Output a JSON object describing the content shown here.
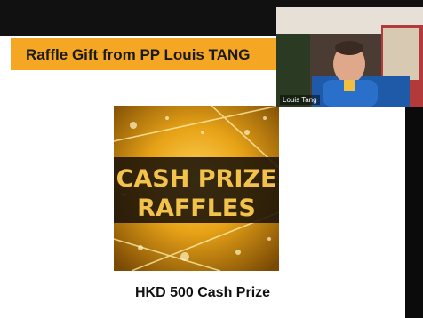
{
  "slide": {
    "banner_title": "Raffle Gift from PP Louis TANG",
    "image_text_line1": "CASH PRIZE",
    "image_text_line2": "RAFFLES",
    "caption": "HKD 500 Cash Prize"
  },
  "video": {
    "participant_name": "Louis Tang"
  },
  "colors": {
    "banner": "#f5a623",
    "gold": "#e8a317",
    "dark": "#111111"
  }
}
